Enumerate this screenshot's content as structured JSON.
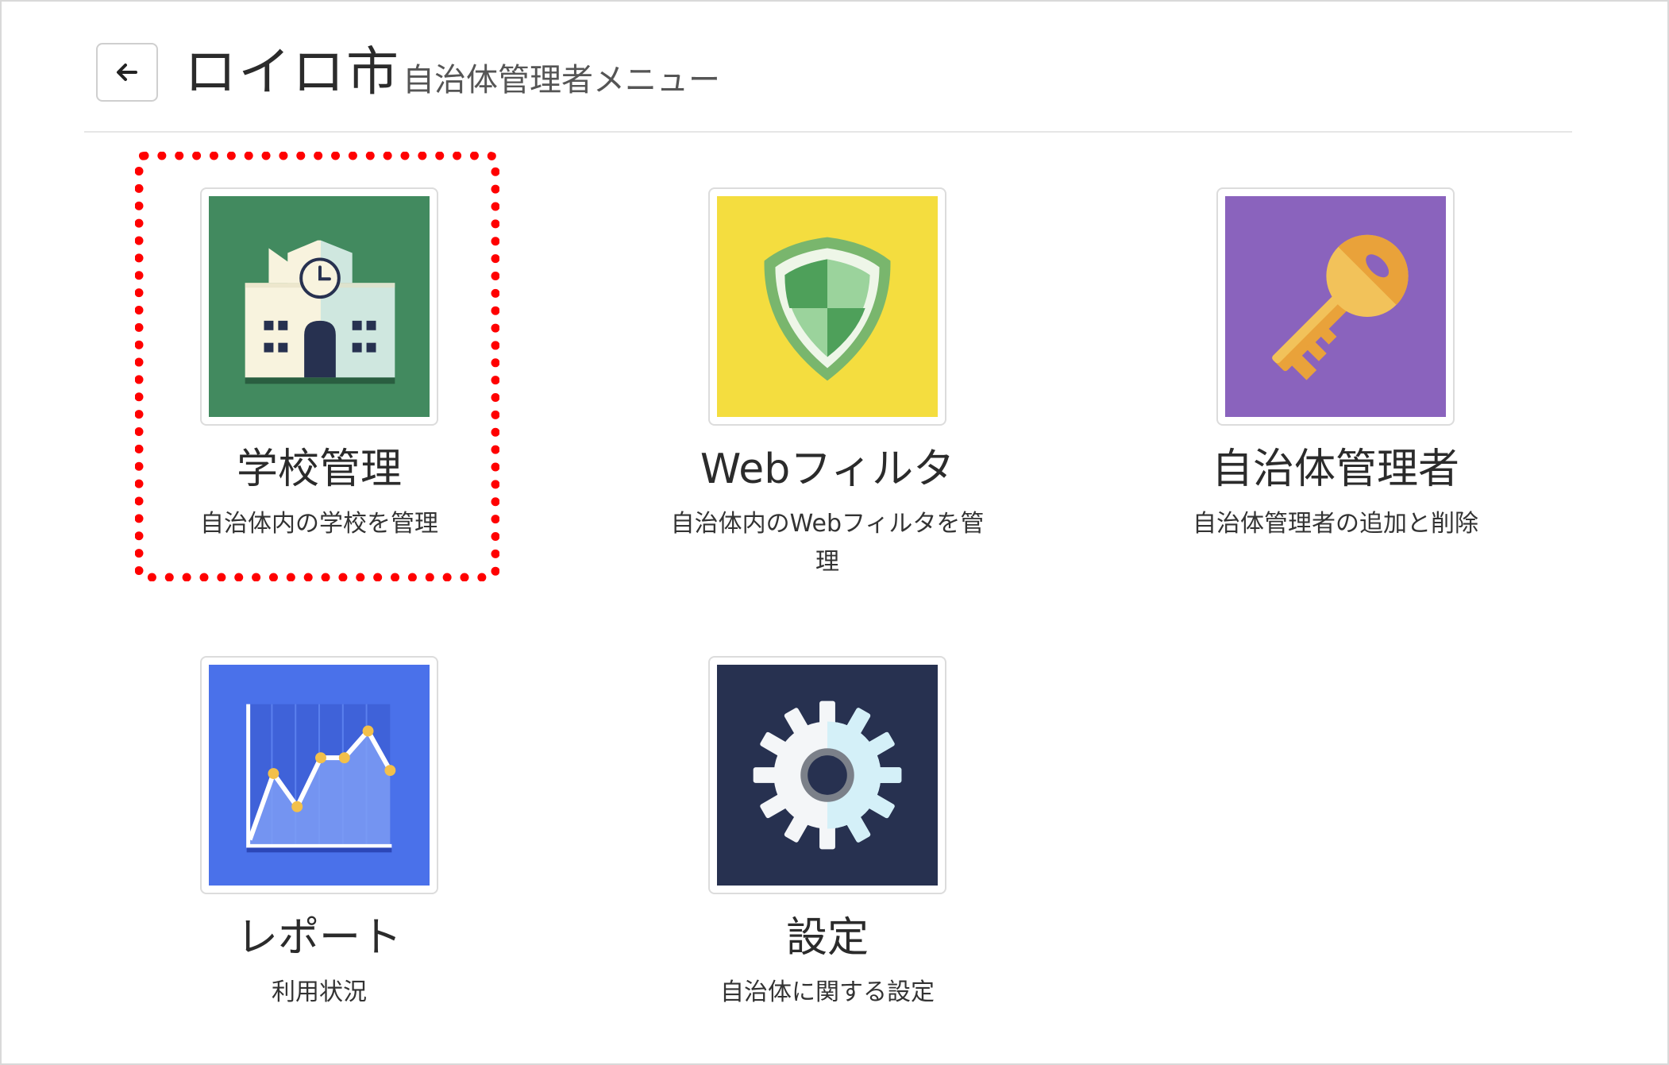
{
  "header": {
    "title": "ロイロ市",
    "subtitle": "自治体管理者メニュー",
    "back_icon": "arrow-left-icon"
  },
  "colors": {
    "school_bg": "#428a5f",
    "web_bg": "#f4dd3f",
    "admin_bg": "#8a63bd",
    "report_bg": "#4a71ea",
    "settings_bg": "#273150",
    "highlight": "#ff0000"
  },
  "tiles": [
    {
      "label": "学校管理",
      "desc": "自治体内の学校を管理",
      "icon": "school-building-icon"
    },
    {
      "label": "Webフィルタ",
      "desc": "自治体内のWebフィルタを管理",
      "icon": "shield-icon"
    },
    {
      "label": "自治体管理者",
      "desc": "自治体管理者の追加と削除",
      "icon": "key-icon"
    },
    {
      "label": "レポート",
      "desc": "利用状況",
      "icon": "line-chart-icon"
    },
    {
      "label": "設定",
      "desc": "自治体に関する設定",
      "icon": "gear-icon"
    }
  ]
}
